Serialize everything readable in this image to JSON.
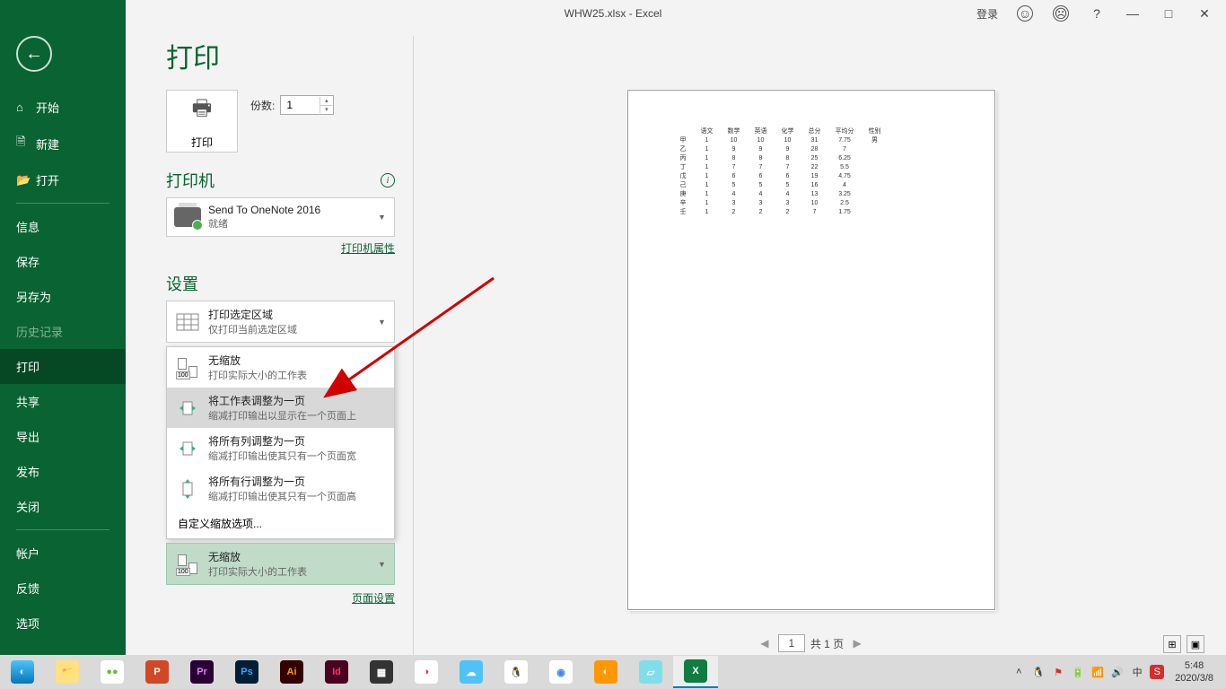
{
  "titlebar": {
    "center": "WHW25.xlsx  -  Excel",
    "login": "登录",
    "help": "?",
    "min": "—",
    "max": "□",
    "close": "✕"
  },
  "sidebar": {
    "back": "←",
    "items": [
      {
        "label": "开始",
        "ico": "⌂"
      },
      {
        "label": "新建",
        "ico": "🗎"
      },
      {
        "label": "打开",
        "ico": "📂"
      },
      {
        "label": "信息",
        "ico": ""
      },
      {
        "label": "保存",
        "ico": ""
      },
      {
        "label": "另存为",
        "ico": ""
      },
      {
        "label": "历史记录",
        "ico": ""
      },
      {
        "label": "打印",
        "ico": ""
      },
      {
        "label": "共享",
        "ico": ""
      },
      {
        "label": "导出",
        "ico": ""
      },
      {
        "label": "发布",
        "ico": ""
      },
      {
        "label": "关闭",
        "ico": ""
      },
      {
        "label": "帐户",
        "ico": ""
      },
      {
        "label": "反馈",
        "ico": ""
      },
      {
        "label": "选项",
        "ico": ""
      }
    ]
  },
  "print": {
    "title": "打印",
    "print_btn": "打印",
    "copies_label": "份数:",
    "copies_value": "1"
  },
  "printer": {
    "section": "打印机",
    "name": "Send To OneNote 2016",
    "status": "就绪",
    "props_link": "打印机属性"
  },
  "settings": {
    "section": "设置",
    "print_area": {
      "t1": "打印选定区域",
      "t2": "仅打印当前选定区域"
    },
    "scale_options": [
      {
        "t1": "无缩放",
        "t2": "打印实际大小的工作表"
      },
      {
        "t1": "将工作表调整为一页",
        "t2": "缩减打印输出以显示在一个页面上"
      },
      {
        "t1": "将所有列调整为一页",
        "t2": "缩减打印输出使其只有一个页面宽"
      },
      {
        "t1": "将所有行调整为一页",
        "t2": "缩减打印输出使其只有一个页面高"
      }
    ],
    "custom_scale": "自定义缩放选项...",
    "current_scale": {
      "t1": "无缩放",
      "t2": "打印实际大小的工作表"
    },
    "page_setup": "页面设置"
  },
  "pager": {
    "current": "1",
    "total": "共 1 页"
  },
  "chart_data": {
    "type": "table",
    "headers": [
      "",
      "语文",
      "数学",
      "英语",
      "化学",
      "总分",
      "平均分",
      "性别"
    ],
    "rows": [
      [
        "甲",
        "1",
        "10",
        "10",
        "10",
        "31",
        "7.75",
        "男"
      ],
      [
        "乙",
        "1",
        "9",
        "9",
        "9",
        "28",
        "7",
        ""
      ],
      [
        "丙",
        "1",
        "8",
        "8",
        "8",
        "25",
        "6.25",
        ""
      ],
      [
        "丁",
        "1",
        "7",
        "7",
        "7",
        "22",
        "5.5",
        ""
      ],
      [
        "戊",
        "1",
        "6",
        "6",
        "6",
        "19",
        "4.75",
        ""
      ],
      [
        "己",
        "1",
        "5",
        "5",
        "5",
        "16",
        "4",
        ""
      ],
      [
        "庚",
        "1",
        "4",
        "4",
        "4",
        "13",
        "3.25",
        ""
      ],
      [
        "辛",
        "1",
        "3",
        "3",
        "3",
        "10",
        "2.5",
        ""
      ],
      [
        "壬",
        "1",
        "2",
        "2",
        "2",
        "7",
        "1.75",
        ""
      ]
    ]
  },
  "taskbar": {
    "time": "5:48",
    "date": "2020/3/8",
    "lang": "中",
    "sogou": "S",
    "tray_up": "˄"
  }
}
